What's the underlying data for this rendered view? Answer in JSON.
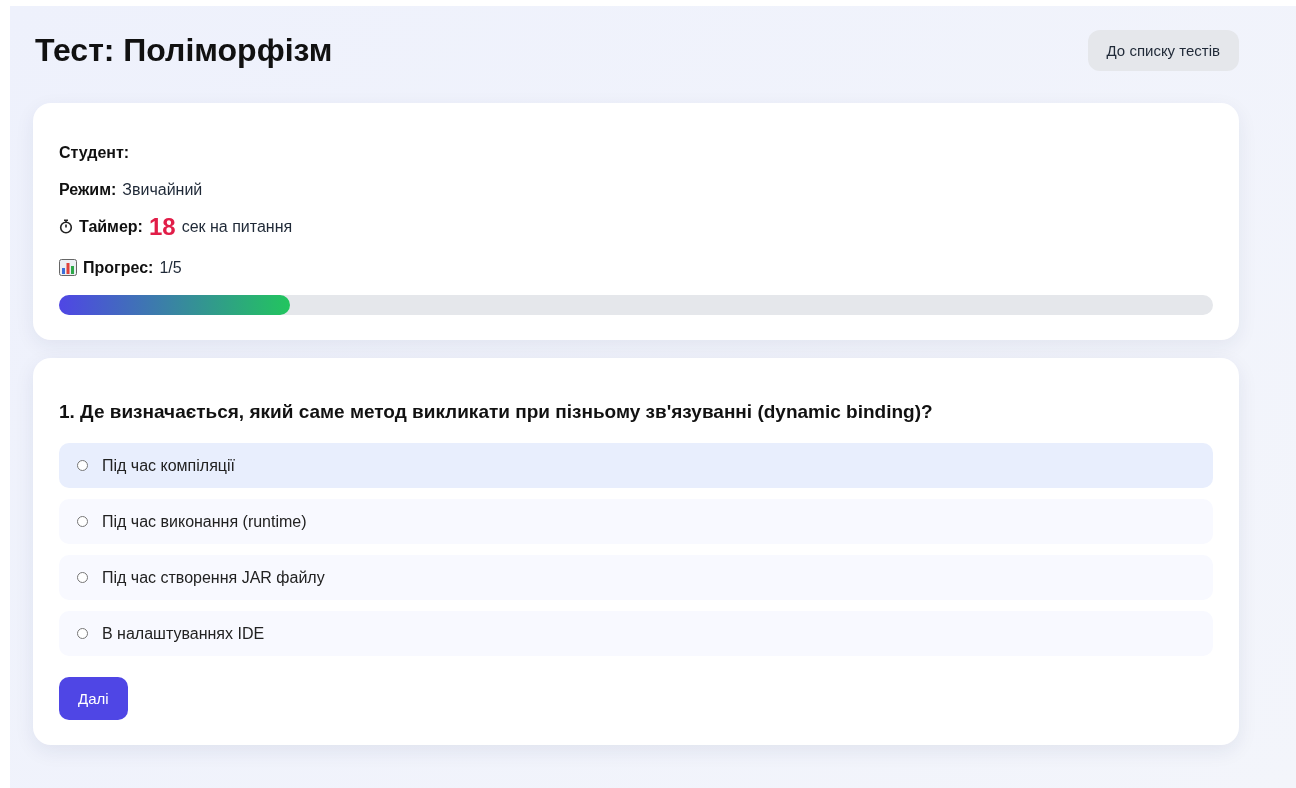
{
  "header": {
    "title": "Тест: Поліморфізм",
    "back_button": "До списку тестів"
  },
  "info": {
    "rows": [
      {
        "kind": "plain",
        "label": "Студент:"
      },
      {
        "kind": "plain",
        "label": "Режим:",
        "value": "Звичайний"
      },
      {
        "kind": "timer",
        "label": "Таймер:",
        "value": "18",
        "unit": "сек на питання"
      },
      {
        "kind": "progress",
        "label": "Прогрес:",
        "value": "1/5"
      }
    ],
    "progress": {
      "level": 0.2
    }
  },
  "question": {
    "text": "1. Де визначається, який саме метод викликати при пізньому зв'язуванні (dynamic binding)?",
    "options": [
      {
        "label": "Під час компіляції",
        "selected": false,
        "highlighted": true
      },
      {
        "label": "Під час виконання (runtime)",
        "selected": false,
        "highlighted": false
      },
      {
        "label": "Під час створення JAR файлу",
        "selected": false,
        "highlighted": false
      },
      {
        "label": "В налаштуваннях IDE",
        "selected": false,
        "highlighted": false
      }
    ],
    "next_button": "Далі"
  }
}
